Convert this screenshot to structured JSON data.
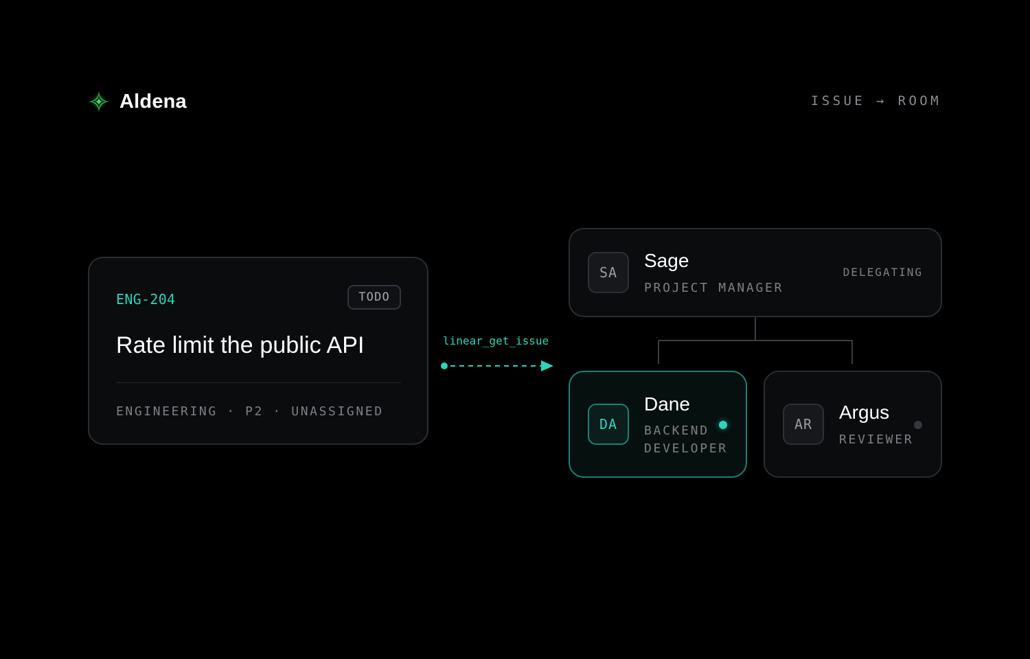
{
  "brand": {
    "name": "Aldena",
    "icon": "sparkle-icon",
    "accent_color": "#3fb950"
  },
  "breadcrumb": "ISSUE → ROOM",
  "issue": {
    "id": "ENG-204",
    "status": "TODO",
    "title": "Rate limit the public API",
    "meta": "ENGINEERING · P2 · UNASSIGNED"
  },
  "connector": {
    "tool": "linear_get_issue",
    "color": "#2ed3ba"
  },
  "agents": {
    "sage": {
      "initials": "SA",
      "name": "Sage",
      "role": "PROJECT MANAGER",
      "status": "DELEGATING"
    },
    "dane": {
      "initials": "DA",
      "name": "Dane",
      "role": "BACKEND DEVELOPER",
      "active": true
    },
    "argus": {
      "initials": "AR",
      "name": "Argus",
      "role": "REVIEWER",
      "active": false
    }
  },
  "colors": {
    "background": "#000000",
    "card": "#0b0c0e",
    "border": "#2a2d31",
    "accent": "#2ed3ba",
    "muted_text": "#7d8085"
  }
}
